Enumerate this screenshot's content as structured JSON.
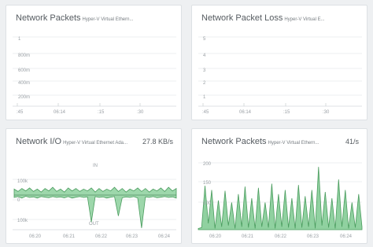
{
  "panels": [
    {
      "title": "Network Packets",
      "subtitle": "Hyper-V Virtual Ethern...",
      "value": "",
      "y_labels": [
        "1",
        "800m",
        "600m",
        "400m",
        "200m"
      ],
      "x_labels": [
        ":45",
        "06:14",
        ":15",
        ":30"
      ]
    },
    {
      "title": "Network Packet Loss",
      "subtitle": "Hyper-V Virtual E...",
      "value": "",
      "y_labels": [
        "5",
        "4",
        "3",
        "2",
        "1"
      ],
      "x_labels": [
        ":45",
        "06:14",
        ":15",
        ":30"
      ]
    },
    {
      "title": "Network I/O",
      "subtitle": "Hyper-V Virtual Ethernet Ada...",
      "value": "27.8 KB/s",
      "y_labels": [
        "100k",
        "0",
        "100k"
      ],
      "in_label": "IN",
      "out_label": "OUT",
      "x_labels": [
        "06:20",
        "06:21",
        "06:22",
        "06:23",
        "06:24"
      ]
    },
    {
      "title": "Network Packets",
      "subtitle": "Hyper-V Virtual Ethern...",
      "value": "41/s",
      "y_labels": [
        "200",
        "150",
        "100"
      ],
      "x_labels": [
        "06:20",
        "06:21",
        "06:22",
        "06:23",
        "06:24"
      ]
    }
  ],
  "colors": {
    "series_line": "#4a9c5e",
    "series_fill": "#7cc98f",
    "grid": "#e8eaec"
  },
  "chart_data": [
    {
      "type": "line",
      "title": "Network I/O",
      "x": [
        "06:20",
        "06:21",
        "06:22",
        "06:23",
        "06:24"
      ],
      "series": [
        {
          "name": "IN",
          "values": [
            20,
            12,
            22,
            14,
            24,
            12,
            20,
            10,
            22,
            14,
            26,
            12,
            20,
            10,
            24,
            14,
            22,
            12,
            20,
            14,
            24,
            10,
            22,
            12,
            20,
            14,
            26,
            12,
            22,
            10,
            20,
            14,
            24,
            12,
            22,
            10,
            20,
            14,
            24,
            12,
            26,
            14,
            22
          ]
        },
        {
          "name": "OUT",
          "values": [
            -8,
            -5,
            -10,
            -4,
            -8,
            -6,
            -10,
            -5,
            -7,
            -9,
            -5,
            -8,
            -6,
            -9,
            -5,
            -10,
            -7,
            -5,
            -8,
            -6,
            -90,
            -5,
            -8,
            -6,
            -10,
            -7,
            -5,
            -70,
            -9,
            -6,
            -8,
            -5,
            -10,
            -110,
            -6,
            -8,
            -5,
            -9,
            -7,
            -5,
            -8,
            -6,
            -10
          ]
        }
      ]
    },
    {
      "type": "area",
      "title": "Network Packets",
      "x": [
        "06:20",
        "06:21",
        "06:22",
        "06:23",
        "06:24"
      ],
      "series": [
        {
          "values": [
            58,
            60,
            160,
            70,
            150,
            58,
            125,
            62,
            148,
            65,
            120,
            58,
            140,
            62,
            158,
            60,
            130,
            58,
            155,
            62,
            120,
            60,
            165,
            58,
            140,
            62,
            150,
            60,
            130,
            58,
            162,
            60,
            135,
            62,
            150,
            58,
            205,
            65,
            145,
            60,
            130,
            58,
            175,
            62,
            150,
            58,
            120,
            60,
            140,
            62
          ]
        }
      ],
      "ylim": [
        55,
        210
      ]
    }
  ]
}
